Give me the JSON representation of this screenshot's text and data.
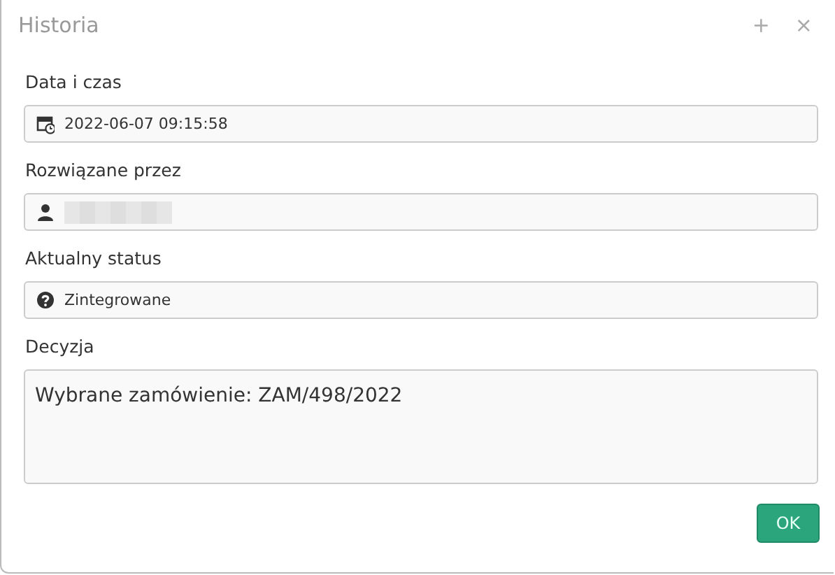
{
  "window": {
    "title": "Historia",
    "controls": [
      "+",
      "×"
    ]
  },
  "fields": [
    {
      "label": "Data i czas",
      "kind": "datetime",
      "value": "2022-06-07 09:15:58"
    },
    {
      "label": "Rozwiązane przez",
      "kind": "user",
      "redacted": true
    },
    {
      "label": "Aktualny status",
      "kind": "status",
      "value": "Zintegrowane"
    }
  ],
  "decision": {
    "label": "Decyzja",
    "value": "Wybrane zamówienie: ZAM/498/2022"
  },
  "buttons": [
    "OK"
  ]
}
